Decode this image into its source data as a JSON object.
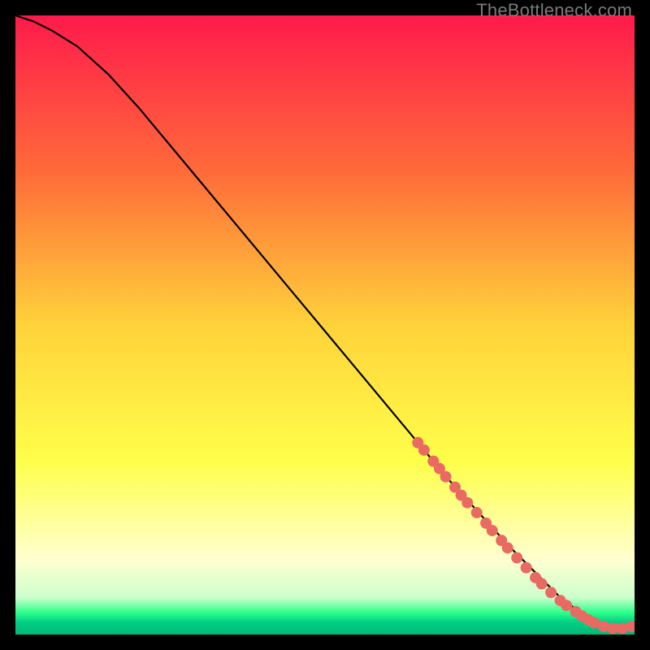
{
  "watermark": "TheBottleneck.com",
  "chart_data": {
    "type": "line",
    "title": "",
    "xlabel": "",
    "ylabel": "",
    "xlim": [
      0,
      100
    ],
    "ylim": [
      0,
      100
    ],
    "grid": false,
    "legend": false,
    "background_gradient": {
      "stops": [
        {
          "offset": 0.0,
          "color": "#ff1a4b"
        },
        {
          "offset": 0.25,
          "color": "#ff6a3a"
        },
        {
          "offset": 0.5,
          "color": "#ffd23a"
        },
        {
          "offset": 0.72,
          "color": "#ffff4a"
        },
        {
          "offset": 0.88,
          "color": "#ffffd0"
        },
        {
          "offset": 0.94,
          "color": "#ccffcc"
        },
        {
          "offset": 0.965,
          "color": "#2aff8a"
        },
        {
          "offset": 0.98,
          "color": "#00d084"
        },
        {
          "offset": 1.0,
          "color": "#00b976"
        }
      ]
    },
    "curve": {
      "note": "Main black bottleneck curve. y is % bottleneck (100=top of plot, 0=bottom). x is normalized 0–100.",
      "x": [
        0,
        3,
        6,
        10,
        15,
        20,
        25,
        30,
        35,
        40,
        45,
        50,
        55,
        60,
        65,
        70,
        75,
        80,
        83,
        86,
        88,
        90,
        92,
        94,
        96,
        98,
        100
      ],
      "y": [
        100,
        99,
        97.5,
        95,
        90.5,
        85,
        79,
        73,
        67,
        61,
        55,
        49,
        43,
        37,
        31,
        25,
        19.5,
        14,
        11,
        8,
        6,
        4.5,
        3,
        2,
        1.3,
        1,
        1.5
      ]
    },
    "highlight_points": {
      "note": "Salmon/coral dots clustered on the lower-right portion of the curve.",
      "color": "#e96a63",
      "points": [
        {
          "x": 65,
          "y": 31
        },
        {
          "x": 66,
          "y": 29.8
        },
        {
          "x": 67.5,
          "y": 28
        },
        {
          "x": 68.5,
          "y": 26.8
        },
        {
          "x": 69.5,
          "y": 25.5
        },
        {
          "x": 71,
          "y": 23.8
        },
        {
          "x": 72,
          "y": 22.5
        },
        {
          "x": 73,
          "y": 21.3
        },
        {
          "x": 74.5,
          "y": 19.7
        },
        {
          "x": 76,
          "y": 18
        },
        {
          "x": 77,
          "y": 16.8
        },
        {
          "x": 78.5,
          "y": 15.2
        },
        {
          "x": 79.5,
          "y": 14
        },
        {
          "x": 81,
          "y": 12.4
        },
        {
          "x": 82.5,
          "y": 10.8
        },
        {
          "x": 84,
          "y": 9.2
        },
        {
          "x": 85,
          "y": 8.2
        },
        {
          "x": 86.5,
          "y": 6.8
        },
        {
          "x": 88,
          "y": 5.5
        },
        {
          "x": 89,
          "y": 4.7
        },
        {
          "x": 90.5,
          "y": 3.7
        },
        {
          "x": 91.5,
          "y": 3
        },
        {
          "x": 92.5,
          "y": 2.4
        },
        {
          "x": 93.5,
          "y": 1.9
        },
        {
          "x": 95,
          "y": 1.3
        },
        {
          "x": 96.5,
          "y": 1
        },
        {
          "x": 98,
          "y": 1
        },
        {
          "x": 99.5,
          "y": 1.3
        }
      ]
    }
  }
}
